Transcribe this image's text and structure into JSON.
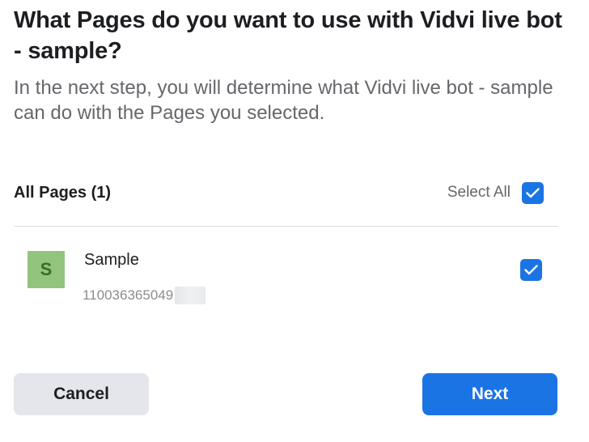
{
  "dialog": {
    "title": "What Pages do you want to use with Vidvi live bot - sample?",
    "subtitle": "In the next step, you will determine what Vidvi live bot - sample can do with the Pages you selected."
  },
  "list": {
    "header_title": "All Pages (1)",
    "select_all_label": "Select All",
    "select_all_checked": true,
    "items": [
      {
        "avatar_letter": "S",
        "name": "Sample",
        "id": "110036365049",
        "checked": true
      }
    ]
  },
  "footer": {
    "cancel_label": "Cancel",
    "next_label": "Next"
  },
  "colors": {
    "primary": "#1b74e4",
    "avatar_bg": "#93c47d",
    "secondary_button": "#e4e6eb"
  },
  "icons": {
    "checkbox_check": "checkmark-icon"
  }
}
